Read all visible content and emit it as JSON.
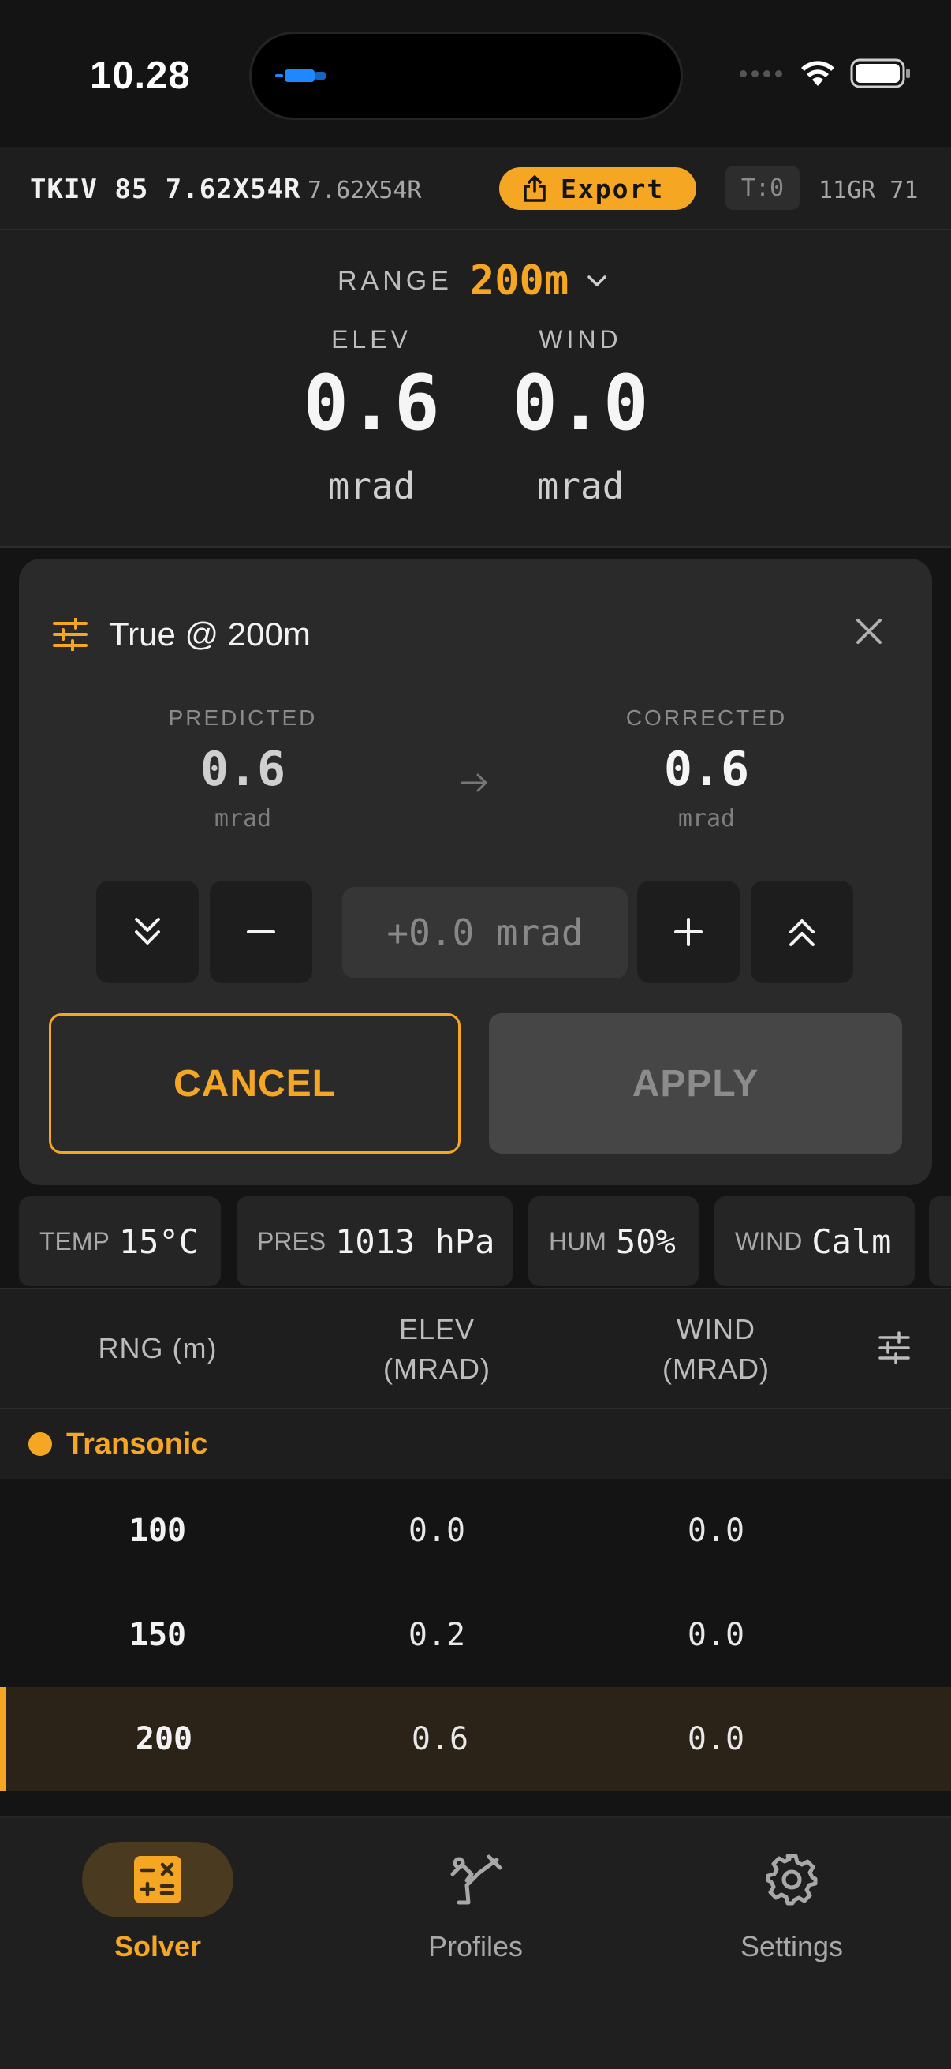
{
  "status_bar": {
    "time": "10.28"
  },
  "header": {
    "profile_title": "TKIV 85 7.62X54R",
    "caliber": "7.62X54R",
    "export_label": "Export",
    "turret_chip": "T:0",
    "bullet": "11GR 71"
  },
  "solution": {
    "range_label": "RANGE",
    "range_value": "200m",
    "elev": {
      "label": "ELEV",
      "value": "0.6",
      "unit": "mrad"
    },
    "wind": {
      "label": "WIND",
      "value": "0.0",
      "unit": "mrad"
    }
  },
  "correction": {
    "title": "True @ 200m",
    "predicted": {
      "label": "PREDICTED",
      "value": "0.6",
      "unit": "mrad"
    },
    "corrected": {
      "label": "CORRECTED",
      "value": "0.6",
      "unit": "mrad"
    },
    "delta": "+0.0 mrad",
    "cancel_label": "CANCEL",
    "apply_label": "APPLY"
  },
  "conditions": [
    {
      "key": "TEMP",
      "value": "15°C"
    },
    {
      "key": "PRES",
      "value": "1013 hPa"
    },
    {
      "key": "HUM",
      "value": "50%"
    },
    {
      "key": "WIND",
      "value": "Calm"
    }
  ],
  "table": {
    "headers": {
      "range": "RNG (m)",
      "elev_1": "ELEV",
      "elev_2": "(MRAD)",
      "wind_1": "WIND",
      "wind_2": "(MRAD)"
    },
    "group_label": "Transonic",
    "rows": [
      {
        "range": "100",
        "elev": "0.0",
        "wind": "0.0"
      },
      {
        "range": "150",
        "elev": "0.2",
        "wind": "0.0"
      },
      {
        "range": "200",
        "elev": "0.6",
        "wind": "0.0"
      }
    ]
  },
  "nav": [
    {
      "label": "Solver",
      "icon": "calculator-icon"
    },
    {
      "label": "Profiles",
      "icon": "rifle-icon"
    },
    {
      "label": "Settings",
      "icon": "gear-icon"
    }
  ],
  "colors": {
    "accent": "#f5a623",
    "background": "#141414",
    "card": "#2a2a2a"
  }
}
